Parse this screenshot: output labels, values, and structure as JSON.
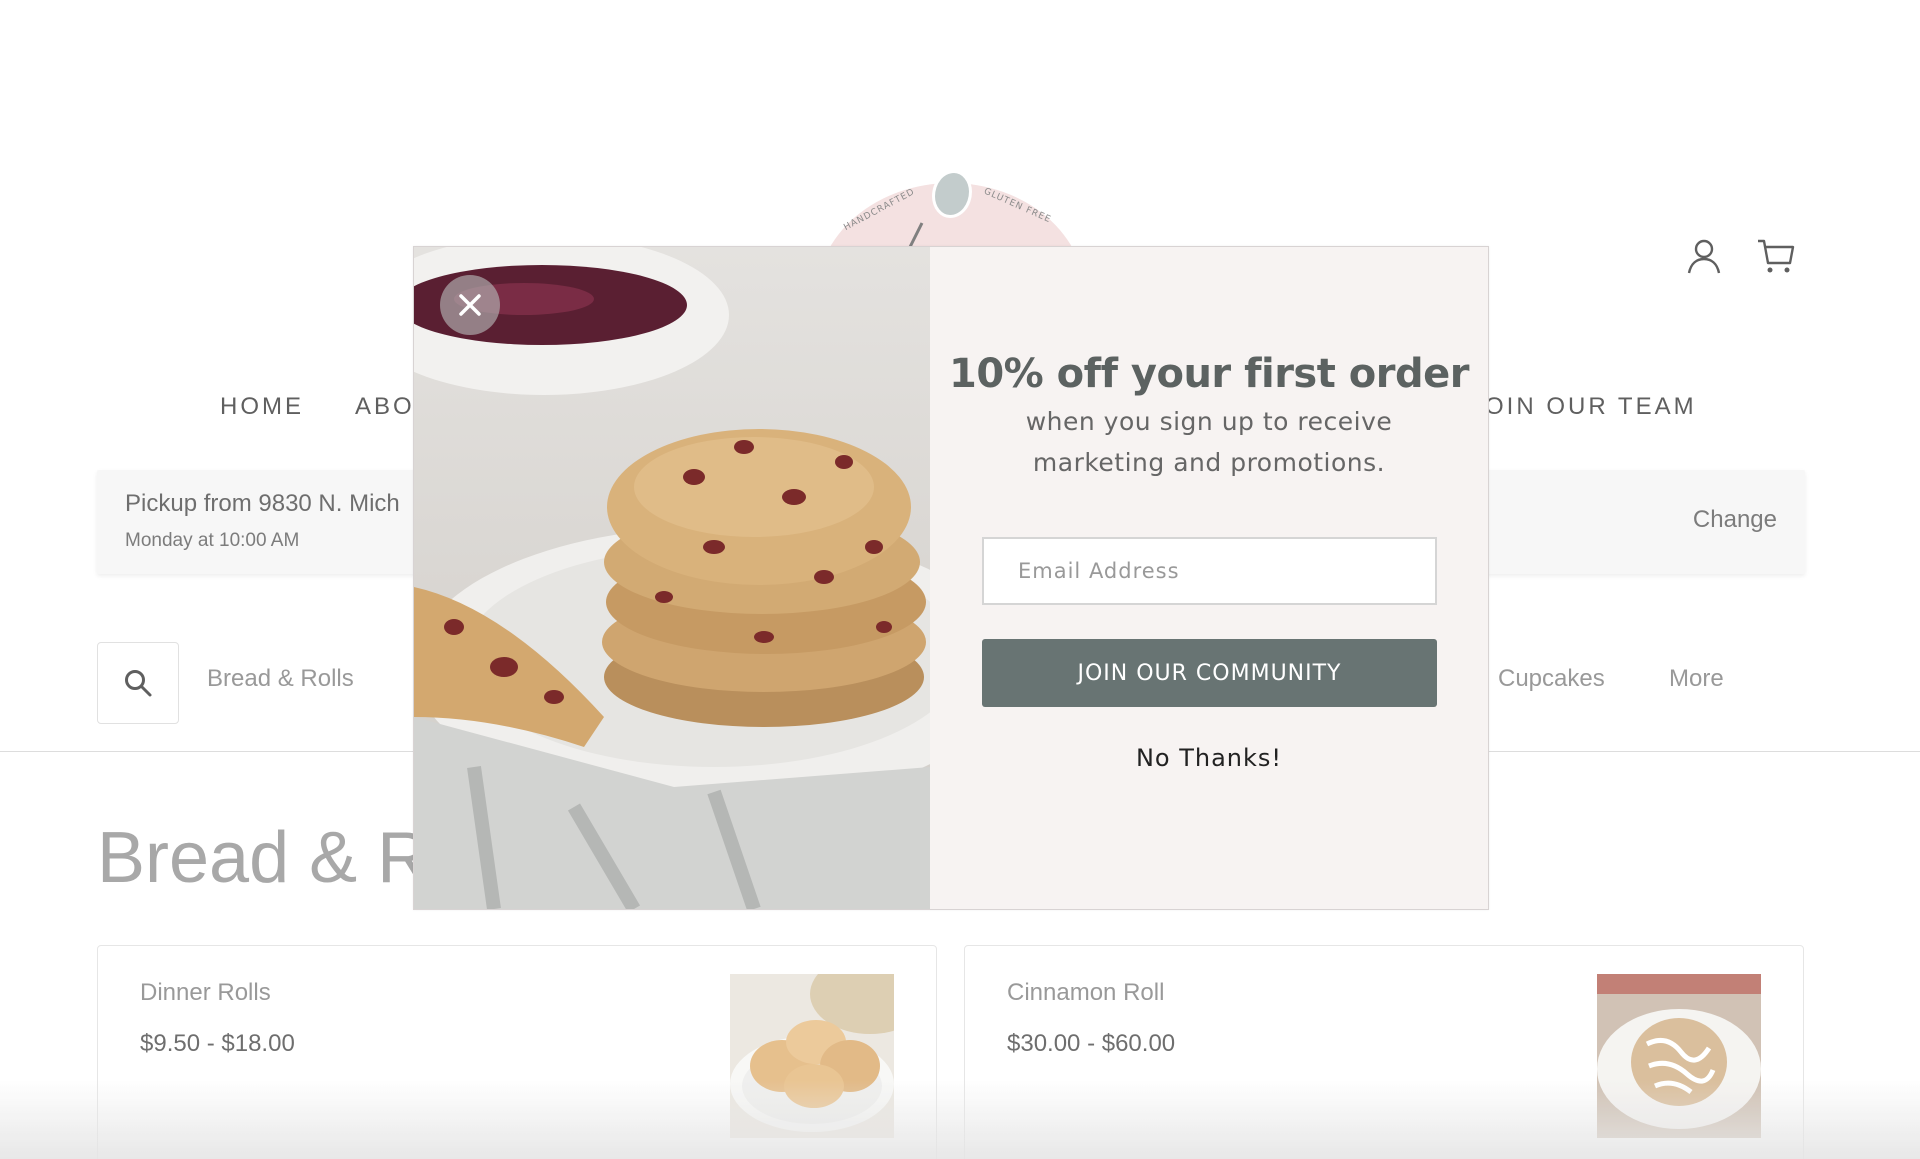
{
  "logo": {
    "text_left": "HANDCRAFTED",
    "text_right": "GLUTEN FREE"
  },
  "header": {
    "account_icon": "user-icon",
    "cart_icon": "cart-icon"
  },
  "nav": {
    "items": [
      "HOME",
      "ABOU",
      "OIN OUR TEAM"
    ]
  },
  "pickup": {
    "location": "Pickup from 9830 N. Mich",
    "time": "Monday at 10:00 AM",
    "change_label": "Change"
  },
  "categories": {
    "search_icon": "search-icon",
    "items": [
      "Bread & Rolls",
      "Cupcakes",
      "More"
    ]
  },
  "section": {
    "title": "Bread & Ro"
  },
  "products": [
    {
      "name": "Dinner Rolls",
      "price": "$9.50 - $18.00"
    },
    {
      "name": "Cinnamon Roll",
      "price": "$30.00 - $60.00"
    }
  ],
  "modal": {
    "title": "10% off your first order",
    "subtitle": "when you sign up to receive marketing and promotions.",
    "email_placeholder": "Email Address",
    "join_label": "JOIN OUR COMMUNITY",
    "no_thanks_label": "No Thanks!",
    "close_icon": "close-icon",
    "accent_color": "#687473",
    "background_color": "#f7f3f2"
  }
}
